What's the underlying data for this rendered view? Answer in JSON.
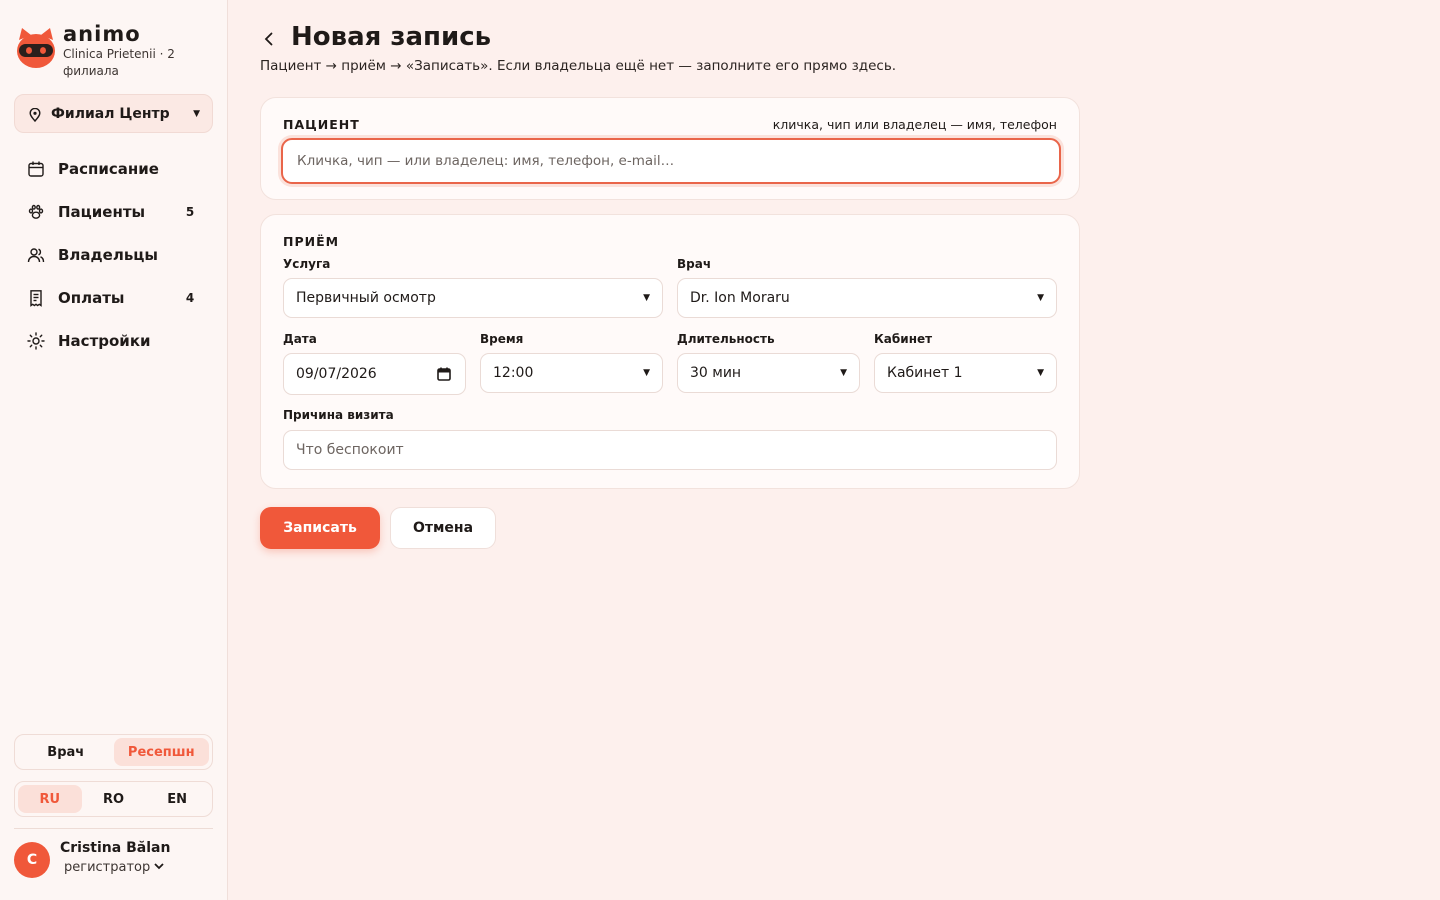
{
  "brand": {
    "name": "animo",
    "subtitle": "Clinica Prietenii · 2 филиала"
  },
  "branch": {
    "label": "Филиал Центр"
  },
  "nav": {
    "items": [
      {
        "label": "Расписание",
        "icon": "calendar-icon",
        "badge": ""
      },
      {
        "label": "Пациенты",
        "icon": "paw-icon",
        "badge": "5"
      },
      {
        "label": "Владельцы",
        "icon": "users-icon",
        "badge": ""
      },
      {
        "label": "Оплаты",
        "icon": "receipt-icon",
        "badge": "4"
      },
      {
        "label": "Настройки",
        "icon": "gear-icon",
        "badge": ""
      }
    ]
  },
  "role_switch": {
    "options": [
      "Врач",
      "Ресепшн"
    ],
    "active": "Ресепшн"
  },
  "lang_switch": {
    "options": [
      "RU",
      "RO",
      "EN"
    ],
    "active": "RU"
  },
  "user": {
    "initial": "C",
    "name": "Cristina Bălan",
    "role": "регистратор"
  },
  "page": {
    "title": "Новая запись",
    "subtitle": "Пациент → приём → «Записать». Если владельца ещё нет — заполните его прямо здесь."
  },
  "patient": {
    "section": "ПАЦИЕНТ",
    "hint": "кличка, чип или владелец — имя, телефон",
    "placeholder": "Кличка, чип — или владелец: имя, телефон, e-mail…",
    "value": ""
  },
  "visit": {
    "section": "ПРИЁМ",
    "service": {
      "label": "Услуга",
      "value": "Первичный осмотр"
    },
    "doctor": {
      "label": "Врач",
      "value": "Dr. Ion Moraru"
    },
    "date": {
      "label": "Дата",
      "value": "09/07/2026"
    },
    "time": {
      "label": "Время",
      "value": "12:00"
    },
    "duration": {
      "label": "Длительность",
      "value": "30 мин"
    },
    "room": {
      "label": "Кабинет",
      "value": "Кабинет 1"
    },
    "reason": {
      "label": "Причина визита",
      "placeholder": "Что беспокоит"
    }
  },
  "actions": {
    "submit": "Записать",
    "cancel": "Отмена"
  },
  "colors": {
    "accent": "#f0583a",
    "background": "#fdf0ed",
    "sidebar": "#fdf6f4"
  }
}
